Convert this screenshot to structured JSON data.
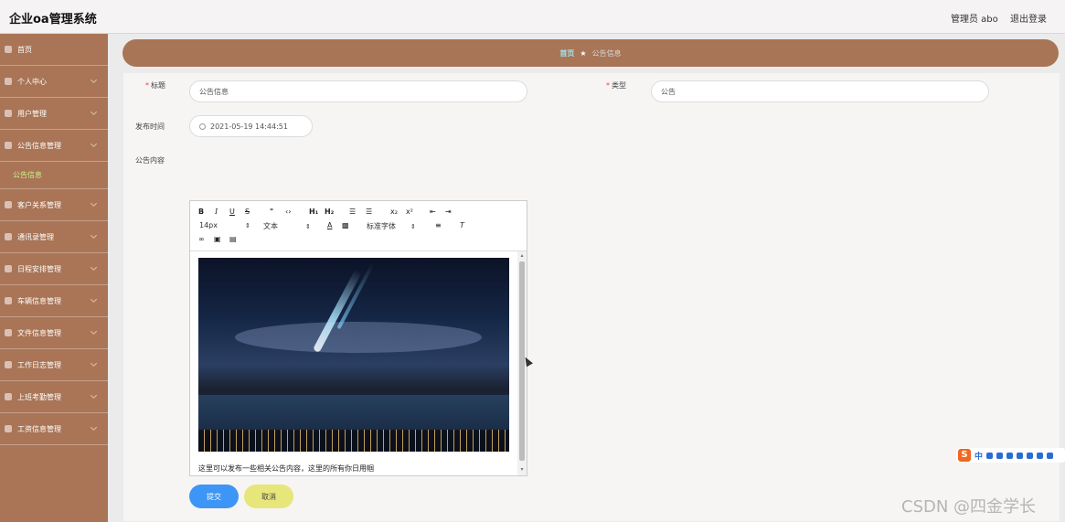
{
  "header": {
    "app_title": "企业oa管理系统",
    "user_label": "管理员 abo",
    "logout_label": "退出登录"
  },
  "sidebar": {
    "items": [
      {
        "label": "首页",
        "has_children": false
      },
      {
        "label": "个人中心",
        "has_children": true
      },
      {
        "label": "用户管理",
        "has_children": true
      },
      {
        "label": "公告信息管理",
        "has_children": true,
        "expanded": true
      }
    ],
    "active_sub": "公告信息",
    "items_after": [
      {
        "label": "客户关系管理"
      },
      {
        "label": "通讯录管理"
      },
      {
        "label": "日程安排管理"
      },
      {
        "label": "车辆信息管理"
      },
      {
        "label": "文件信息管理"
      },
      {
        "label": "工作日志管理"
      },
      {
        "label": "上班考勤管理"
      },
      {
        "label": "工资信息管理"
      }
    ]
  },
  "breadcrumb": {
    "home": "首页",
    "separator": "★",
    "current": "公告信息"
  },
  "form": {
    "title_label": "标题",
    "title_value": "公告信息",
    "type_label": "类型",
    "type_value": "公告",
    "time_label": "发布时间",
    "time_value": "2021-05-19 14:44:51",
    "content_label": "公告内容"
  },
  "editor": {
    "font_size": "14px",
    "block_type": "文本",
    "font_family": "标准字体",
    "body_text": "这里可以发布一些相关公告内容，这里的所有你日用帼"
  },
  "buttons": {
    "submit": "提交",
    "cancel": "取消"
  },
  "ime": {
    "logo": "S",
    "text": "中"
  },
  "watermark": "CSDN @四金学长"
}
